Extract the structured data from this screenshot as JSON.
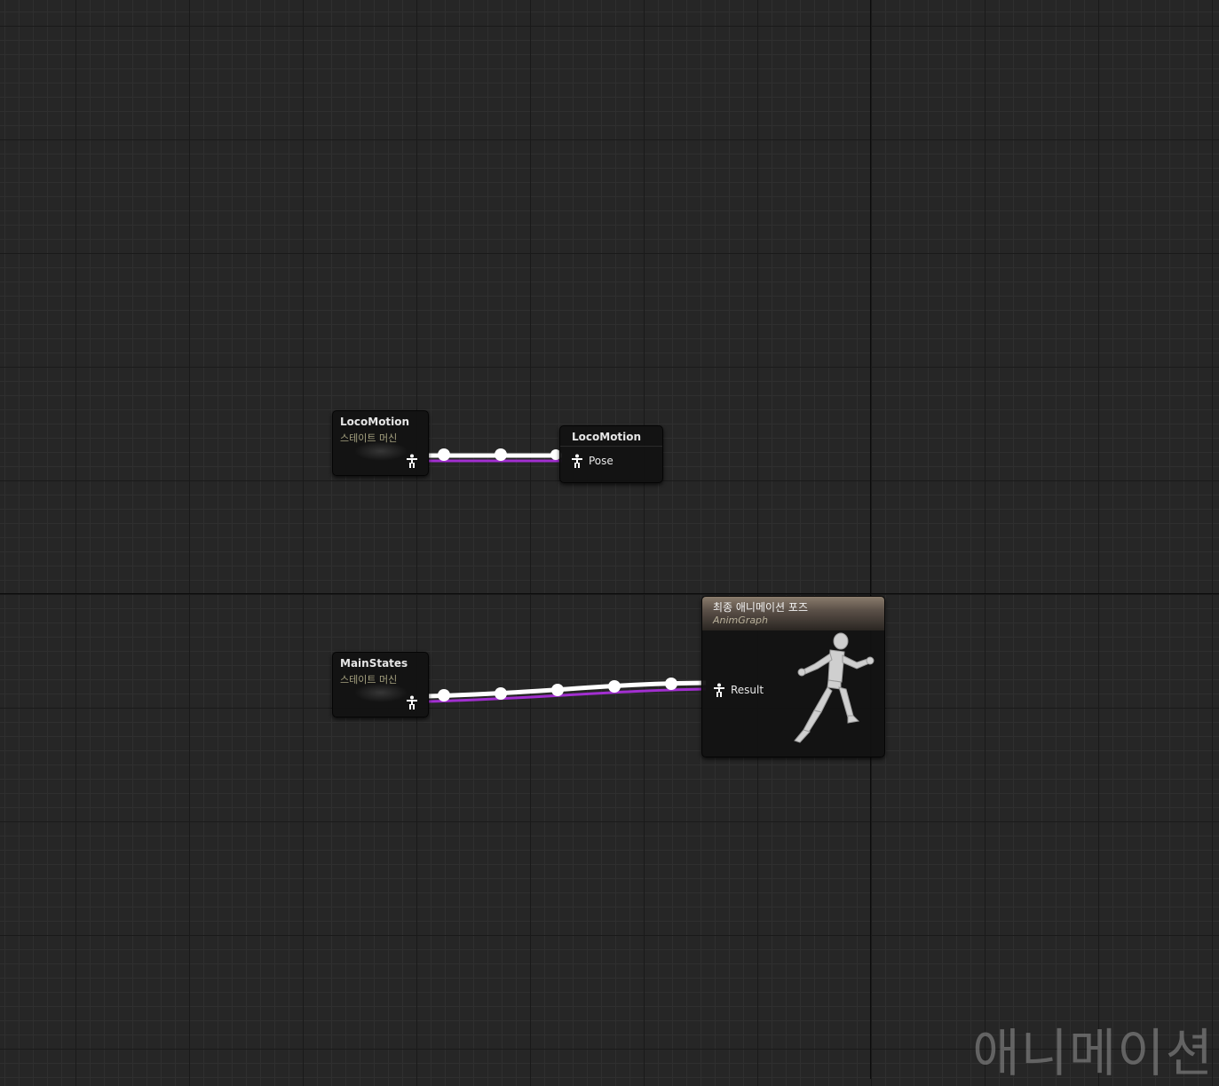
{
  "nodes": {
    "locomotion_machine": {
      "title": "LocoMotion",
      "subtitle": "스테이트 머신"
    },
    "locomotion_pose": {
      "title": "LocoMotion",
      "pin_label": "Pose"
    },
    "mainstates_machine": {
      "title": "MainStates",
      "subtitle": "스테이트 머신"
    },
    "output_pose": {
      "title": "최종 애니메이션 포즈",
      "subtitle": "AnimGraph",
      "pin_label": "Result"
    }
  },
  "watermark": "애니메이션",
  "icons": {
    "pose_pin": "pose-figure-icon",
    "output_figure": "running-mannequin-icon"
  },
  "colors": {
    "wire": "#ffffff",
    "wire_shadow": "#a22fd0",
    "header": "#8a7c6c"
  }
}
